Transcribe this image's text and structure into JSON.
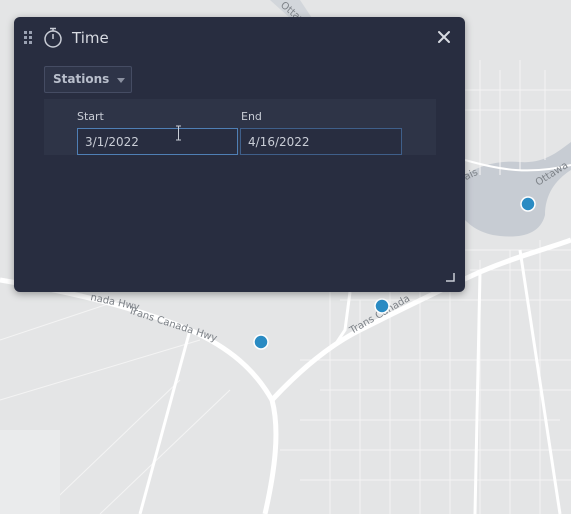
{
  "panel": {
    "title": "Time",
    "dropdown": {
      "selected": "Stations"
    },
    "range": {
      "start_label": "Start",
      "start_value": "3/1/2022",
      "end_label": "End",
      "end_value": "4/16/2022"
    }
  },
  "map": {
    "road_labels": {
      "trans_canada_1": "Trans Canada Hwy",
      "trans_canada_2": "Trans Canada Hwy",
      "trans_canada_3": "Trans Canada",
      "ottawa_river": "Ottawa Ri",
      "nada_hwy": "nada Hwy",
      "rais": "rais"
    }
  },
  "colors": {
    "panel_bg": "#282d40",
    "map_bg": "#e4e5e6",
    "point": "#2a8bc3",
    "input_border": "#4f7fb5"
  },
  "icons": {
    "drag": "drag-handle-icon",
    "clock": "stopwatch-icon",
    "close": "close-icon",
    "caret": "chevron-down-icon",
    "resize": "resize-handle-icon"
  }
}
